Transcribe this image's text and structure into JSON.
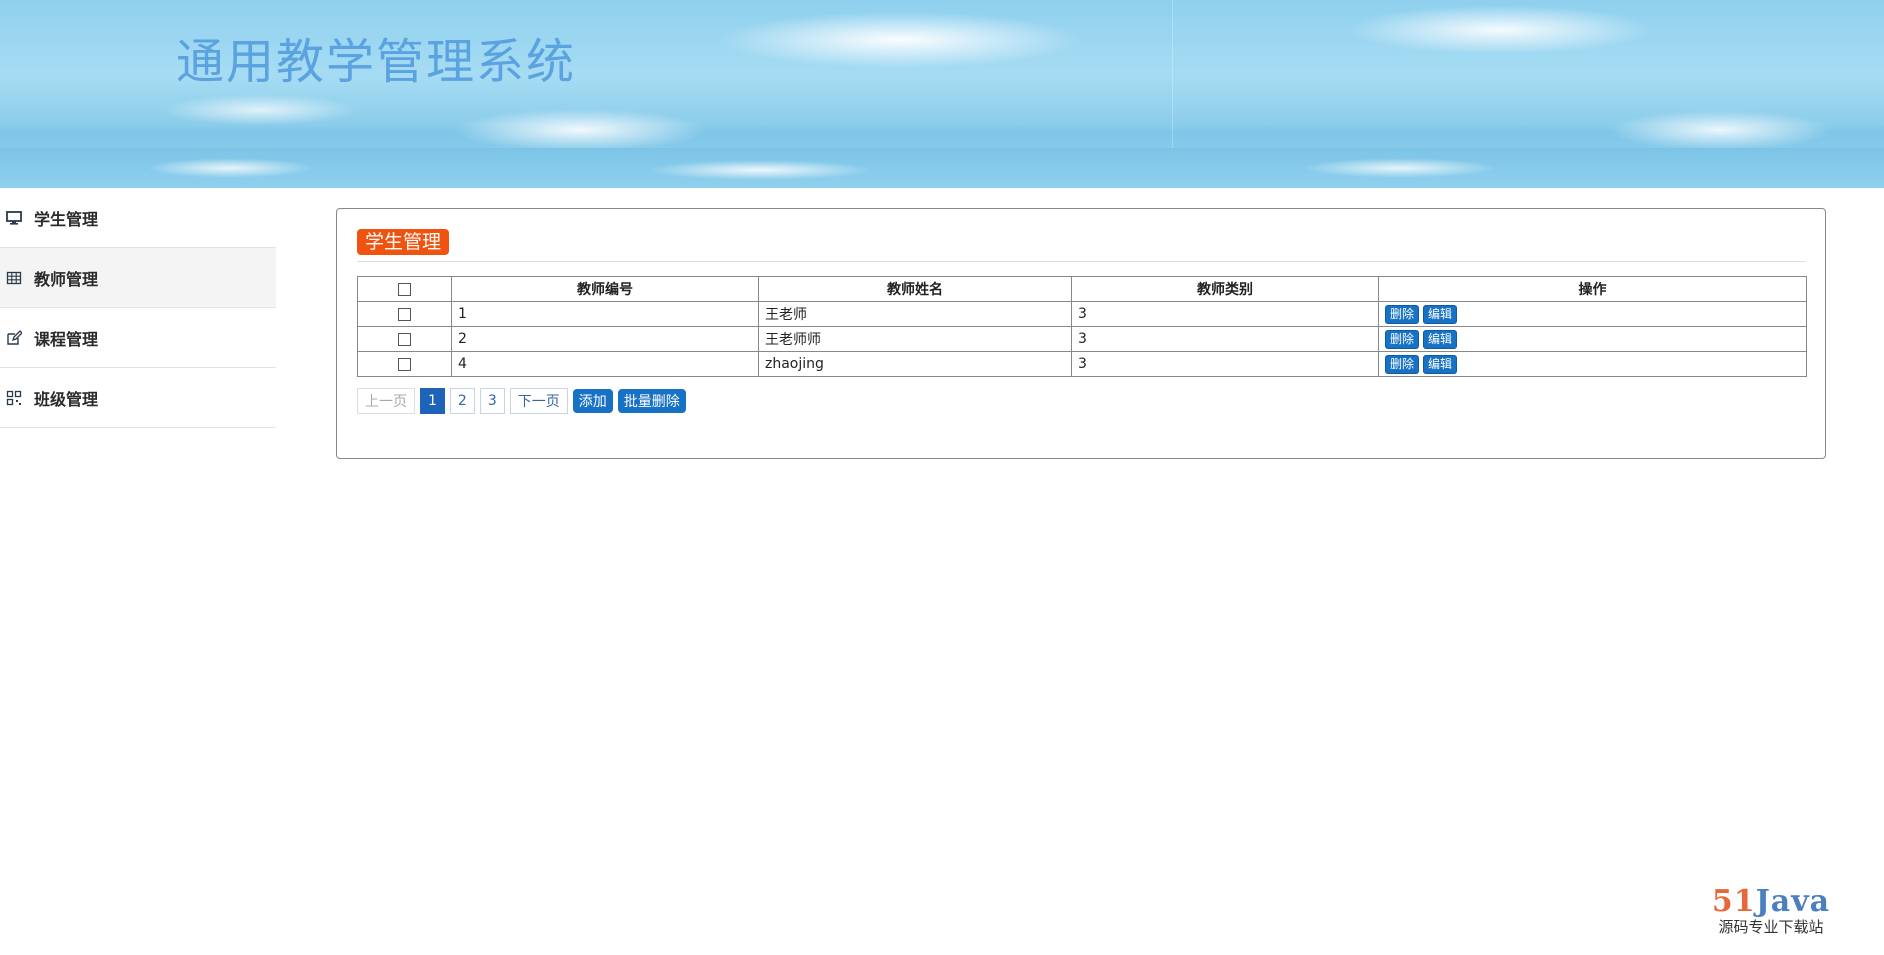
{
  "app": {
    "title": "通用教学管理系统"
  },
  "sidebar": {
    "items": [
      {
        "label": "学生管理",
        "icon": "monitor-icon",
        "active": false
      },
      {
        "label": "教师管理",
        "icon": "table-icon",
        "active": true
      },
      {
        "label": "课程管理",
        "icon": "edit-icon",
        "active": false
      },
      {
        "label": "班级管理",
        "icon": "qrcode-icon",
        "active": false
      }
    ]
  },
  "panel": {
    "title": "学生管理"
  },
  "table": {
    "columns": [
      "教师编号",
      "教师姓名",
      "教师类别",
      "操作"
    ],
    "rows": [
      {
        "id": "1",
        "name": "王老师",
        "type": "3"
      },
      {
        "id": "2",
        "name": "王老师师",
        "type": "3"
      },
      {
        "id": "4",
        "name": "zhaojing",
        "type": "3"
      }
    ],
    "actions": {
      "delete_label": "删除",
      "edit_label": "编辑"
    }
  },
  "pager": {
    "prev_label": "上一页",
    "pages": [
      "1",
      "2",
      "3"
    ],
    "current_page": "1",
    "next_label": "下一页",
    "add_label": "添加",
    "batch_delete_label": "批量删除"
  },
  "watermark": {
    "logo_num": "51",
    "logo_text": "Java",
    "subtitle": "源码专业下载站"
  },
  "colors": {
    "accent_orange": "#f0520f",
    "primary_blue": "#1771c4",
    "title_blue": "#5aa2e0"
  }
}
